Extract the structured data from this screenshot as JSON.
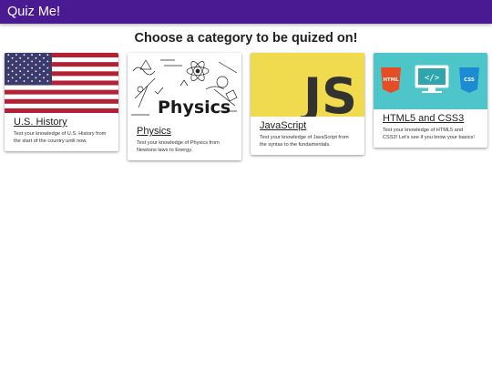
{
  "app": {
    "title": "Quiz Me!"
  },
  "main": {
    "heading": "Choose a category to be quized on!"
  },
  "categories": [
    {
      "title": "U.S. History",
      "description": "Test your knowledge of U.S. History from the start of the country until now."
    },
    {
      "title": "Physics",
      "description": "Test your knowledge of Physics from Newtons laws to Energy."
    },
    {
      "title": "JavaScript",
      "description": "Test your knowledge of JavaScript from the syntax to the fundamentals."
    },
    {
      "title": "HTML5 and CSS3",
      "description": "Test your knowledge of HTML5 and CSS3! Let's see if you know your basics!"
    }
  ],
  "images": {
    "physics_word": "Physics",
    "js_logo": "JS",
    "html_badge": "HTML",
    "css_badge": "CSS",
    "code_symbol": "</>"
  },
  "colors": {
    "appbar": "#4a1a92",
    "flag_red": "#b22234",
    "flag_blue": "#3c3b6e",
    "js_yellow": "#f0db4f",
    "html_orange": "#e44d26",
    "css_blue": "#1b8bd4",
    "teal_bg": "#4ec6c9"
  }
}
